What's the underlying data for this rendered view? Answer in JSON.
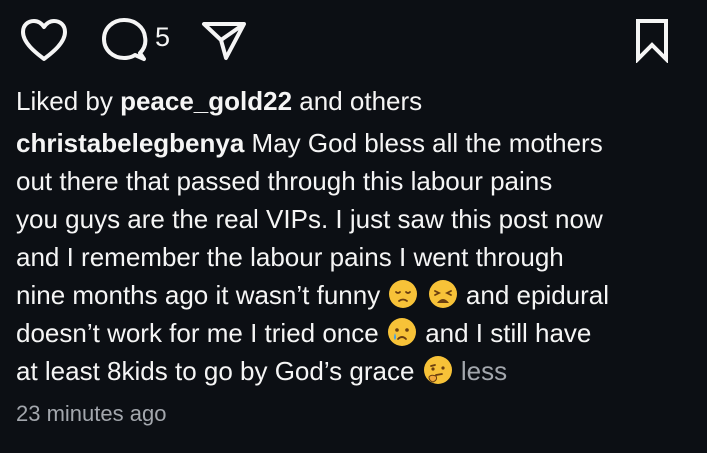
{
  "actions": {
    "like_icon": "heart-icon",
    "comment_icon": "comment-bubble-icon",
    "comment_count": "5",
    "share_icon": "paper-plane-icon",
    "save_icon": "bookmark-icon"
  },
  "likes": {
    "prefix": "Liked by",
    "user": "peace_gold22",
    "suffix": "and others"
  },
  "caption": {
    "username": "christabelegbenya",
    "line1": "May God bless all the mothers",
    "line2": "out there that passed through this labour pains",
    "line3": "you guys are the real VIPs. I just saw this post now",
    "line4": "and I remember the labour pains I went through",
    "line5_text": "nine months ago it wasn’t funny",
    "line5_after": "and epidural",
    "line6_before": "doesn’t work for me I tried once",
    "line6_after": "and I still have",
    "line7_text": "at least 8kids to go by God’s grace",
    "less_label": "less",
    "emojis": [
      "pensive-face",
      "weary-face",
      "crying-face",
      "thinking-face"
    ]
  },
  "timestamp": "23 minutes ago",
  "colors": {
    "background": "#0c0f14",
    "text": "#f5f5f5",
    "muted": "#a3a7ad",
    "emoji": "#f7c238"
  }
}
